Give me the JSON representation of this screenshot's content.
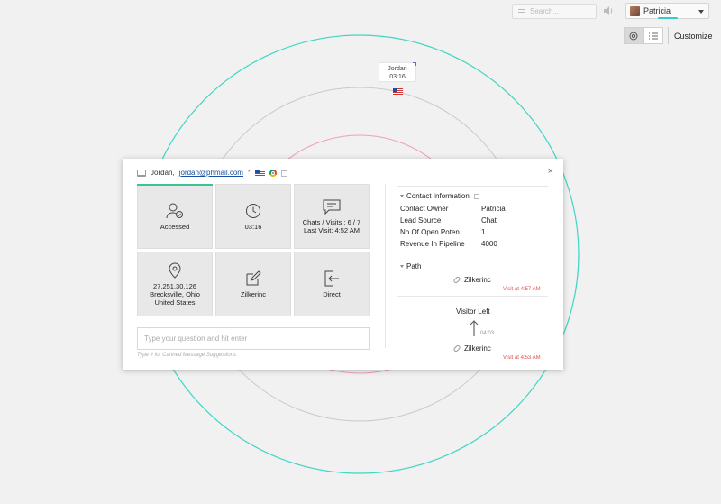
{
  "topbar": {
    "search_placeholder": "Search...",
    "user_name": "Patricia",
    "customize_label": "Customize"
  },
  "visitor": {
    "name": "Jordan",
    "time": "03:16"
  },
  "dialog": {
    "header": {
      "name": "Jordan,",
      "email": "jordan@phmail.com",
      "required_mark": "*"
    },
    "close_label": "×",
    "tiles": [
      {
        "icon": "user-check-icon",
        "label": "Accessed"
      },
      {
        "icon": "clock-icon",
        "label": "03:16"
      },
      {
        "icon": "chat-icon",
        "line1": "Chats / Visits : 6 / 7",
        "line2": "Last Visit: 4:52 AM"
      },
      {
        "icon": "location-pin-icon",
        "line1": "27.251.30.126",
        "line2": "Brecksville, Ohio",
        "line3": "United States"
      },
      {
        "icon": "edit-icon",
        "label": "Zilkerinc"
      },
      {
        "icon": "direct-entry-icon",
        "label": "Direct"
      }
    ],
    "question_placeholder": "Type your question and hit enter",
    "hint": "Type # for Canned Message Suggestions",
    "contact": {
      "title": "Contact Information",
      "rows": [
        {
          "key": "Contact Owner",
          "value": "Patricia"
        },
        {
          "key": "Lead Source",
          "value": "Chat"
        },
        {
          "key": "No Of Open Poten...",
          "value": "1"
        },
        {
          "key": "Revenue In Pipeline",
          "value": "4000"
        }
      ]
    },
    "path": {
      "title": "Path",
      "first_page": "Zilkerinc",
      "first_visit": "Visit at 4:57 AM",
      "visitor_left": "Visitor Left",
      "gap_time": "04:03",
      "second_page": "Zilkerinc",
      "second_visit": "Visit at 4:53 AM"
    }
  },
  "colors": {
    "accent_green": "#39c39a",
    "outer_ring": "#3fd6c4",
    "mid_ring": "#c8c8d4",
    "inner_ring": "#f0a0b0",
    "visit_red": "#e05050"
  }
}
